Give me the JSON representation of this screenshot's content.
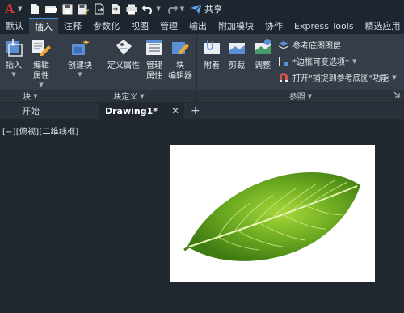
{
  "app": {
    "logo_letter": "A",
    "accent": "#3f8fd8",
    "logo_color": "#e03030"
  },
  "quick_access": {
    "icons": [
      "new-file-icon",
      "open-folder-icon",
      "save-icon",
      "save-as-icon",
      "export-icon",
      "import-icon",
      "print-icon",
      "undo-icon",
      "redo-icon"
    ],
    "share_label": "共享"
  },
  "ribbon_tabs": [
    {
      "label": "默认",
      "active": false
    },
    {
      "label": "插入",
      "active": true
    },
    {
      "label": "注释",
      "active": false
    },
    {
      "label": "参数化",
      "active": false
    },
    {
      "label": "视图",
      "active": false
    },
    {
      "label": "管理",
      "active": false
    },
    {
      "label": "输出",
      "active": false
    },
    {
      "label": "附加模块",
      "active": false
    },
    {
      "label": "协作",
      "active": false
    },
    {
      "label": "Express Tools",
      "active": false
    },
    {
      "label": "精选应用",
      "active": false
    }
  ],
  "panels": {
    "block": {
      "title": "块",
      "insert": "插入",
      "edit_attr_line1": "编辑",
      "edit_attr_line2": "属性"
    },
    "block_def": {
      "title": "块定义",
      "create_block": "创建块",
      "define_attr": "定义属性",
      "manage_attr_line1": "管理",
      "manage_attr_line2": "属性",
      "block_editor_line1": "块",
      "block_editor_line2": "编辑器"
    },
    "reference": {
      "title": "参照",
      "attach": "附着",
      "clip": "剪裁",
      "adjust": "调整",
      "underlay_layers": "参考底图图层",
      "frame_variable": "*边框可变选项*",
      "snap_underlay": "打开\"捕捉到参考底图\"功能"
    }
  },
  "document_tabs": {
    "start_label": "开始",
    "active_label": "Drawing1*",
    "close_glyph": "✕",
    "add_glyph": "+"
  },
  "viewport": {
    "label": "[−][俯视][二维线框]"
  },
  "canvas_image": {
    "subject": "leaf-image",
    "leaf_color": "#6aa820"
  }
}
